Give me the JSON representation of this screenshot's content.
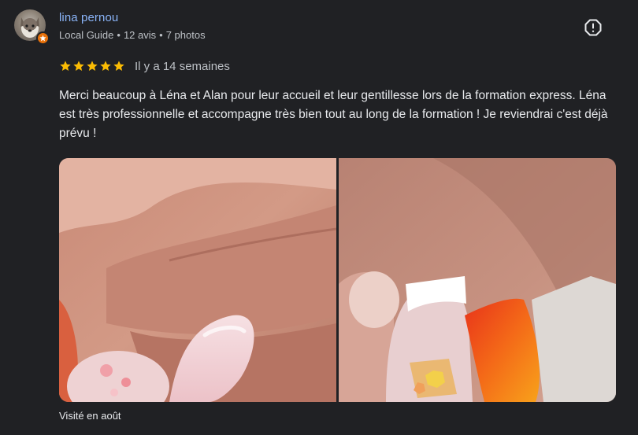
{
  "author": {
    "name": "lina pernou",
    "badge": "Local Guide",
    "reviews_count": "12 avis",
    "photos_count": "7 photos",
    "separator": "•"
  },
  "review": {
    "rating": 5,
    "max_rating": 5,
    "date": "Il y a 14 semaines",
    "text": "Merci beaucoup à Léna et Alan pour leur accueil et leur gentillesse lors de la formation express. Léna est très professionnelle et accompagne très bien tout au long de la formation ! Je reviendrai c'est déjà prévu !",
    "visit": "Visité en août"
  },
  "photos": [
    {
      "icon": "nail-photo-pink"
    },
    {
      "icon": "nail-photo-french-orange"
    }
  ],
  "colors": {
    "background": "#202124",
    "link": "#8ab4f8",
    "star": "#fbbc04",
    "guide_badge": "#e8710a",
    "secondary_text": "#bdc1c6"
  }
}
